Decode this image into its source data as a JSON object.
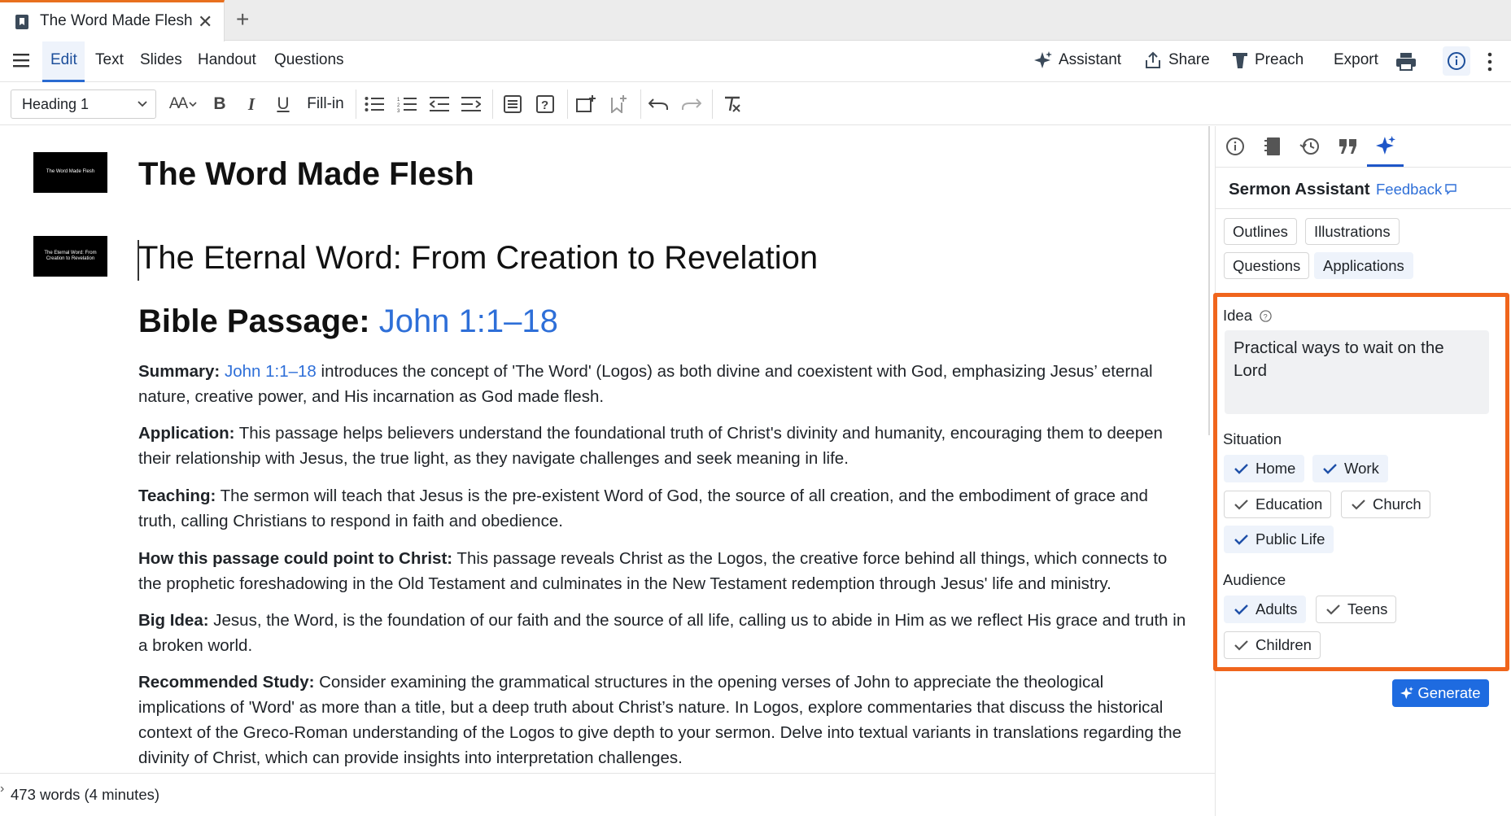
{
  "tab": {
    "title": "The Word Made Flesh",
    "close": "✕",
    "new": "+"
  },
  "menu": {
    "items": [
      "Edit",
      "Text",
      "Slides",
      "Handout",
      "Questions"
    ],
    "right": {
      "assistant": "Assistant",
      "share": "Share",
      "preach": "Preach",
      "export": "Export"
    }
  },
  "toolbar": {
    "style": "Heading 1",
    "fillin": "Fill-in",
    "font_size_label": "AA"
  },
  "editor": {
    "title": "The Word Made Flesh",
    "thumb1": "The Word Made Flesh",
    "thumb2": "The Eternal Word: From Creation to Revelation",
    "heading2": "The Eternal Word: From Creation to Revelation",
    "passage_label": "Bible Passage:",
    "passage_ref": "John 1:1–18",
    "summary_label": "Summary:",
    "summary_ref": "John 1:1–18",
    "summary_text": " introduces the concept of 'The Word' (Logos) as both divine and coexistent with God, emphasizing Jesus’ eternal nature, creative power, and His incarnation as God made flesh.",
    "application_label": "Application:",
    "application_text": " This passage helps believers understand the foundational truth of Christ's divinity and humanity, encouraging them to deepen their relationship with Jesus, the true light, as they navigate challenges and seek meaning in life.",
    "teaching_label": "Teaching:",
    "teaching_text": " The sermon will teach that Jesus is the pre-existent Word of God, the source of all creation, and the embodiment of grace and truth, calling Christians to respond in faith and obedience.",
    "christ_label": "How this passage could point to Christ:",
    "christ_text": " This passage reveals Christ as the Logos, the creative force behind all things, which connects to the prophetic foreshadowing in the Old Testament and culminates in the New Testament redemption through Jesus' life and ministry.",
    "bigidea_label": "Big Idea:",
    "bigidea_text": " Jesus, the Word, is the foundation of our faith and the source of all life, calling us to abide in Him as we reflect His grace and truth in a broken world.",
    "study_label": "Recommended Study:",
    "study_text": " Consider examining the grammatical structures in the opening verses of John to appreciate the theological implications of 'Word' as more than a title, but a deep truth about Christ’s nature. In Logos, explore commentaries that discuss the historical context of the Greco-Roman understanding of the Logos to give depth to your sermon. Delve into textual variants in translations regarding the divinity of Christ, which can provide insights into interpretation challenges."
  },
  "status": {
    "wordcount": "473 words (4 minutes)"
  },
  "panel": {
    "title": "Sermon Assistant",
    "feedback": "Feedback",
    "tabs": [
      "Outlines",
      "Illustrations",
      "Questions",
      "Applications"
    ],
    "active_tab": "Applications",
    "idea_label": "Idea",
    "idea_value": "Practical ways to wait on the Lord",
    "situation_label": "Situation",
    "situations": [
      {
        "label": "Home",
        "checked": true
      },
      {
        "label": "Work",
        "checked": true
      },
      {
        "label": "Education",
        "checked": false
      },
      {
        "label": "Church",
        "checked": false
      },
      {
        "label": "Public Life",
        "checked": true
      }
    ],
    "audience_label": "Audience",
    "audiences": [
      {
        "label": "Adults",
        "checked": true
      },
      {
        "label": "Teens",
        "checked": false
      },
      {
        "label": "Children",
        "checked": false
      }
    ],
    "generate": "Generate"
  },
  "colors": {
    "accent": "#1e6be0",
    "highlight": "#f0651c",
    "link": "#2e6fd8",
    "tab_accent": "#e8701e"
  }
}
